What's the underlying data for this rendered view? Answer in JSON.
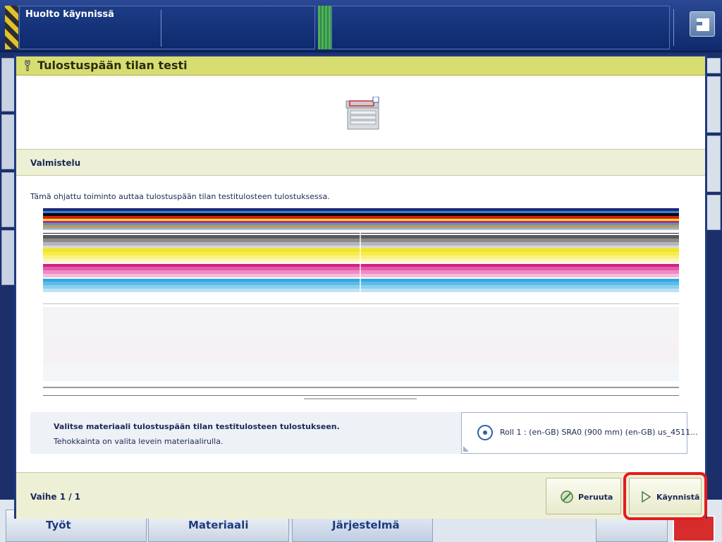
{
  "topbar": {
    "status_text": "Huolto käynnissä"
  },
  "bottom_nav": {
    "tabs": [
      {
        "label": "Työt"
      },
      {
        "label": "Materiaali"
      },
      {
        "label": "Järjestelmä"
      }
    ]
  },
  "dialog": {
    "title": "Tulostuspään tilan testi",
    "section_title": "Valmistelu",
    "intro": "Tämä ohjattu toiminto auttaa tulostuspään tilan testitulosteen tulostuksessa.",
    "material": {
      "title": "Valitse materiaali tulostuspään tilan testitulosteen tulostukseen.",
      "description": "Tehokkainta on valita levein materiaalirulla.",
      "selected_value": "Roll 1 : (en-GB) SRA0 (900 mm) (en-GB) us_4511..."
    },
    "footer": {
      "step": "Vaihe 1 / 1",
      "cancel_label": "Peruuta",
      "start_label": "Käynnistä"
    }
  },
  "colors": {
    "title_bar": "#d8dd72",
    "section_bg": "#eef0d6",
    "highlight": "#e21c1c",
    "frame": "#1f3a7e"
  },
  "icons": {
    "title": "wrench-icon",
    "printer": "printer-icon",
    "roll": "media-roll-icon",
    "cancel": "cancel-icon",
    "start": "play-icon"
  }
}
